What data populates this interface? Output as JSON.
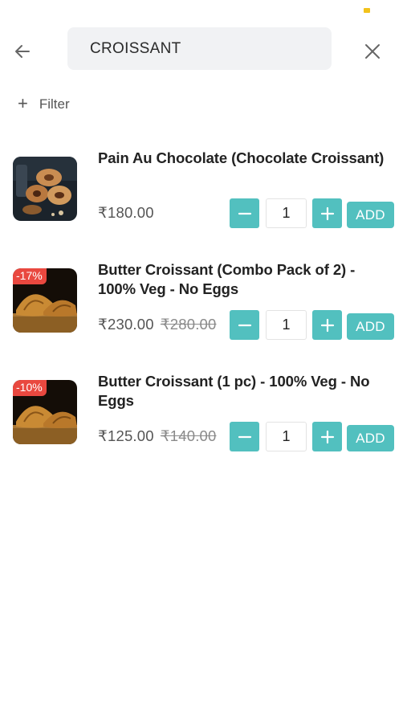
{
  "header": {
    "search_value": "CROISSANT",
    "filter_label": "Filter"
  },
  "colors": {
    "accent": "#52c0bf",
    "discount_badge": "#e9483f",
    "search_bg": "#f1f2f4"
  },
  "products": [
    {
      "name": "Pain Au Chocolate (Chocolate Croissant)",
      "price": "₹180.00",
      "old_price": "",
      "discount": "",
      "quantity": "1",
      "add_label": "ADD",
      "image_icon": "chocolate-croissant-image"
    },
    {
      "name": "Butter Croissant (Combo Pack of 2) - 100% Veg - No Eggs",
      "price": "₹230.00",
      "old_price": "₹280.00",
      "discount": "-17%",
      "quantity": "1",
      "add_label": "ADD",
      "image_icon": "butter-croissant-image"
    },
    {
      "name": "Butter Croissant (1 pc) - 100% Veg - No Eggs",
      "price": "₹125.00",
      "old_price": "₹140.00",
      "discount": "-10%",
      "quantity": "1",
      "add_label": "ADD",
      "image_icon": "butter-croissant-image"
    }
  ]
}
